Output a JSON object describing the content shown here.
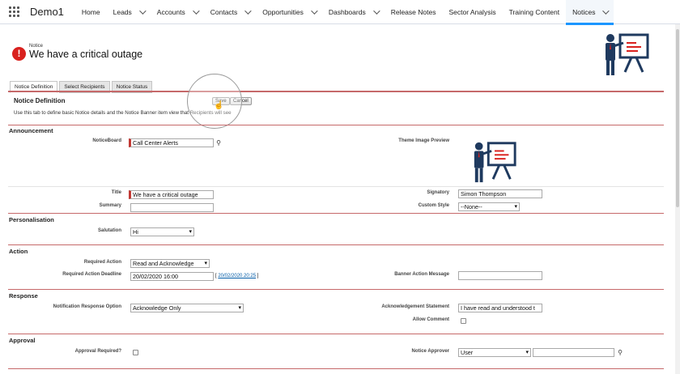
{
  "nav": {
    "app_name": "Demo1",
    "items": [
      {
        "label": "Home",
        "chev": false
      },
      {
        "label": "Leads",
        "chev": true
      },
      {
        "label": "Accounts",
        "chev": true
      },
      {
        "label": "Contacts",
        "chev": true
      },
      {
        "label": "Opportunities",
        "chev": true
      },
      {
        "label": "Dashboards",
        "chev": true
      },
      {
        "label": "Release Notes",
        "chev": false
      },
      {
        "label": "Sector Analysis",
        "chev": false
      },
      {
        "label": "Training Content",
        "chev": false
      },
      {
        "label": "Notices",
        "chev": true,
        "active": true
      }
    ]
  },
  "header": {
    "object_label": "Notice",
    "title": "We have a critical outage"
  },
  "tabs": [
    "Notice Definition",
    "Select Recipients",
    "Notice Status"
  ],
  "panel": {
    "title": "Notice Definition",
    "description": "Use this tab to define basic Notice details and the Notice Banner item view that Recipients will see",
    "save": "Save",
    "cancel": "Cancel"
  },
  "announcement": {
    "title": "Announcement",
    "noticeboard_label": "NoticeBoard",
    "noticeboard_value": "Call Center Alerts",
    "theme_label": "Theme Image Preview",
    "title_label": "Title",
    "title_value": "We have a critical outage",
    "signatory_label": "Signatory",
    "signatory_value": "Simon Thompson",
    "summary_label": "Summary",
    "summary_value": "",
    "custom_style_label": "Custom Style",
    "custom_style_value": "--None--"
  },
  "personalisation": {
    "title": "Personalisation",
    "salutation_label": "Salutation",
    "salutation_value": "Hi"
  },
  "action": {
    "title": "Action",
    "required_action_label": "Required Action",
    "required_action_value": "Read and Acknowledge",
    "deadline_label": "Required Action Deadline",
    "deadline_value": "20/02/2020 16:00",
    "deadline_link": "20/02/2020 20:25",
    "banner_msg_label": "Banner Action Message",
    "banner_msg_value": ""
  },
  "response": {
    "title": "Response",
    "option_label": "Notification Response Option",
    "option_value": "Acknowledge Only",
    "ack_label": "Acknowledgement Statement",
    "ack_value": "I have read and understood t",
    "allow_comment_label": "Allow Comment"
  },
  "approval": {
    "title": "Approval",
    "required_label": "Approval Required?",
    "approver_label": "Notice Approver",
    "approver_type": "User",
    "approver_value": ""
  },
  "colors": {
    "accent_line": "#c6696a",
    "required_bar": "#c23934",
    "nav_active": "#1b96ff",
    "alert": "#d9211e",
    "icon_navy": "#1f3a5f",
    "icon_red": "#d9211e"
  }
}
